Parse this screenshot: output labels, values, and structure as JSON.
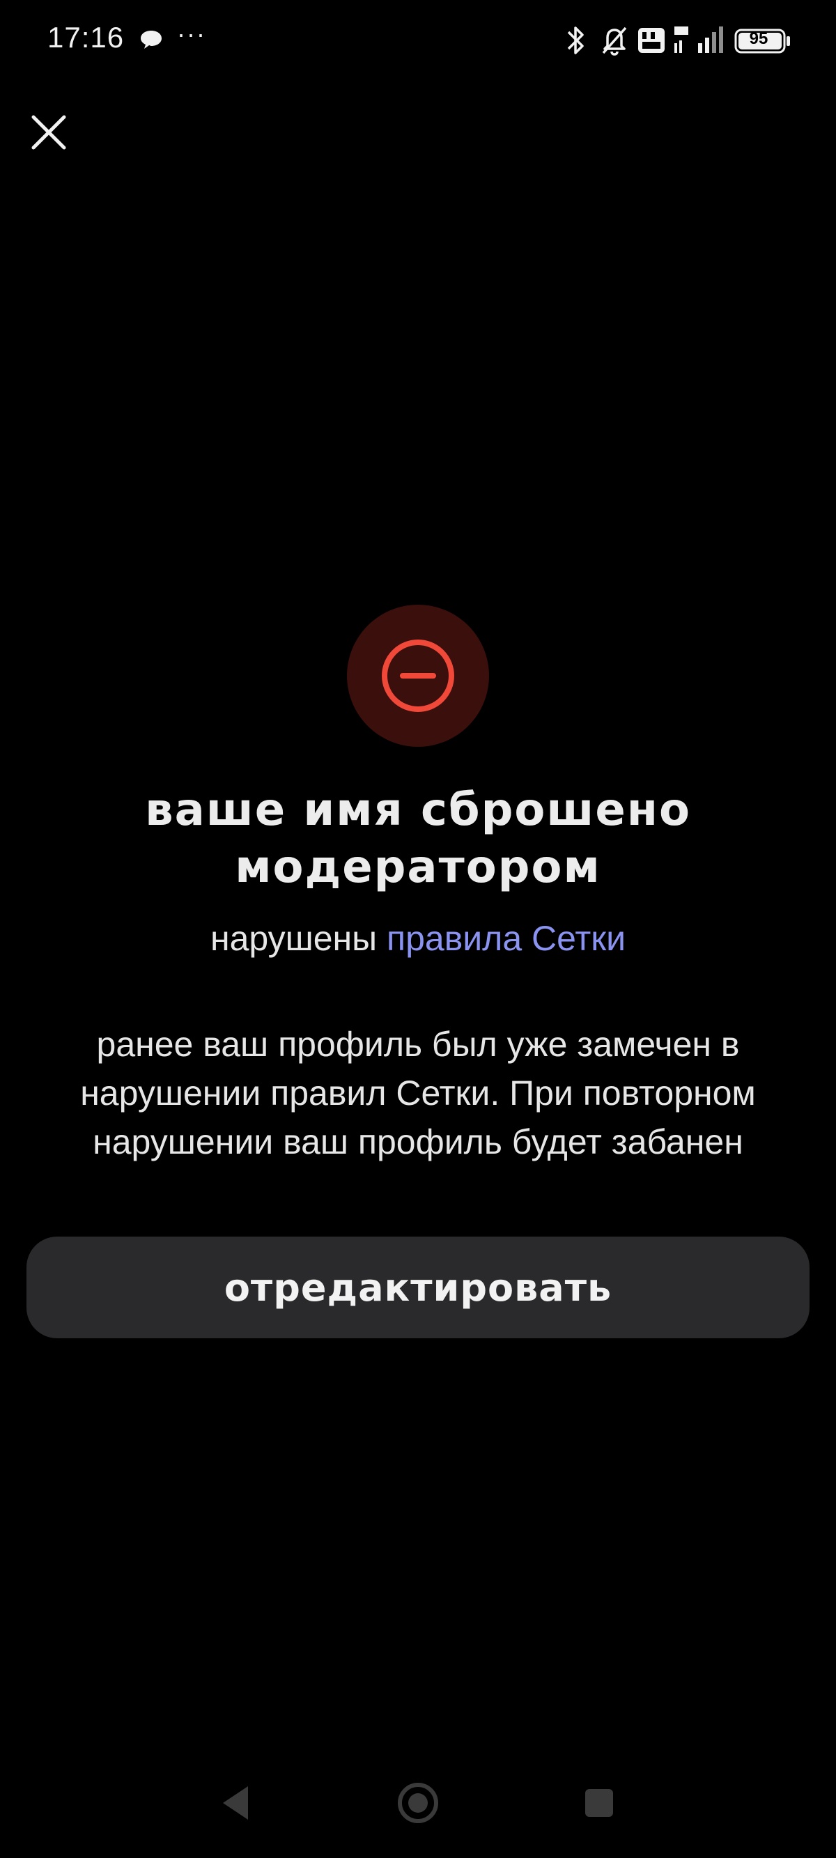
{
  "status_bar": {
    "time": "17:16",
    "more": "···",
    "battery_level": "95",
    "icons": [
      "chat-bubble-icon",
      "bluetooth-icon",
      "bell-off-icon",
      "volte-icon",
      "signal-icon",
      "battery-icon"
    ]
  },
  "dialog": {
    "close_icon": "close-icon",
    "alert_icon": "minus-circle-icon",
    "title_line1": "ваше имя сброшено",
    "title_line2": "модератором",
    "subtitle_prefix": "нарушены ",
    "subtitle_link": "правила Сетки",
    "description_line1": "ранее ваш профиль был уже замечен в",
    "description_line2": "нарушении правил Сетки. При повторном",
    "description_line3": "нарушении ваш профиль будет забанен",
    "edit_button_label": "отредактировать"
  },
  "colors": {
    "background": "#000000",
    "accent_red": "#f0493a",
    "alert_circle_bg": "#3a0f0c",
    "link": "#8a93f0",
    "button_bg": "#2a2a2c"
  },
  "nav_bar": {
    "icons": [
      "back-icon",
      "home-icon",
      "recent-apps-icon"
    ]
  }
}
